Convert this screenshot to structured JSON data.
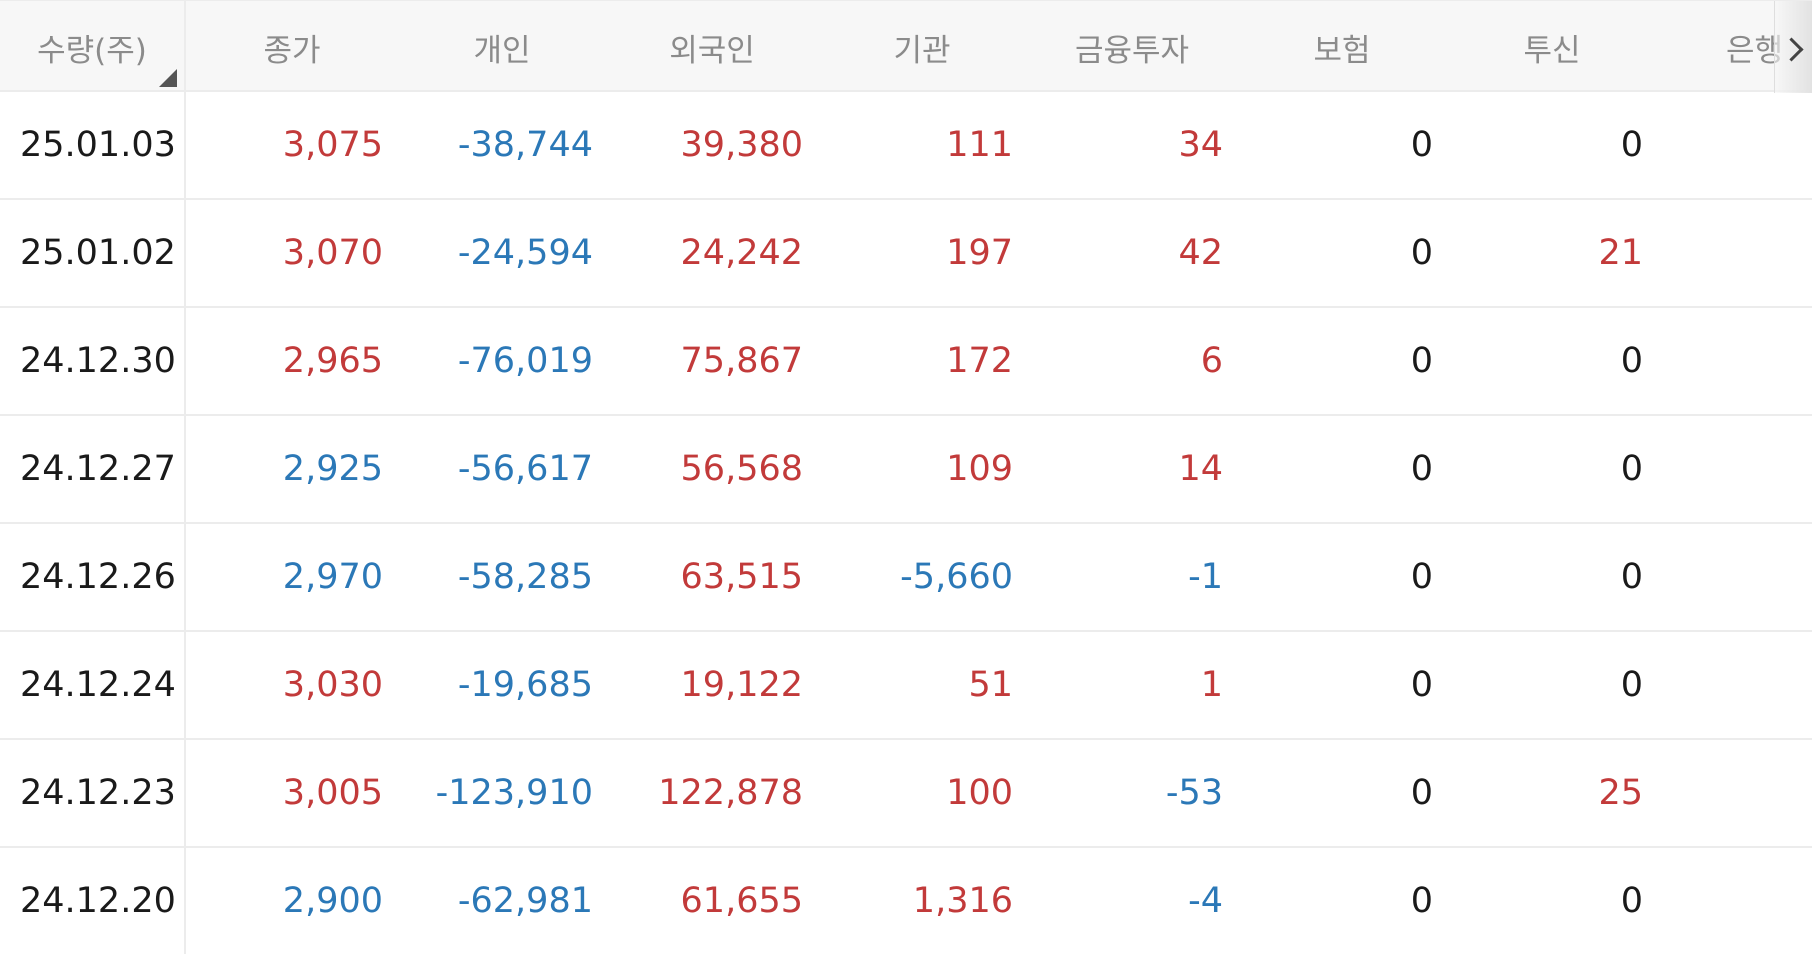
{
  "header": {
    "columns": [
      "수량(주)",
      "종가",
      "개인",
      "외국인",
      "기관",
      "금융투자",
      "보험",
      "투신",
      "은행"
    ]
  },
  "rows": [
    {
      "date": "25.01.03",
      "values": [
        "3,075",
        "-38,744",
        "39,380",
        "111",
        "34",
        "0",
        "0"
      ],
      "signs": [
        "pos",
        "neg",
        "pos",
        "pos",
        "pos",
        "zero",
        "zero"
      ]
    },
    {
      "date": "25.01.02",
      "values": [
        "3,070",
        "-24,594",
        "24,242",
        "197",
        "42",
        "0",
        "21"
      ],
      "signs": [
        "pos",
        "neg",
        "pos",
        "pos",
        "pos",
        "zero",
        "pos"
      ]
    },
    {
      "date": "24.12.30",
      "values": [
        "2,965",
        "-76,019",
        "75,867",
        "172",
        "6",
        "0",
        "0"
      ],
      "signs": [
        "pos",
        "neg",
        "pos",
        "pos",
        "pos",
        "zero",
        "zero"
      ]
    },
    {
      "date": "24.12.27",
      "values": [
        "2,925",
        "-56,617",
        "56,568",
        "109",
        "14",
        "0",
        "0"
      ],
      "signs": [
        "neg",
        "neg",
        "pos",
        "pos",
        "pos",
        "zero",
        "zero"
      ]
    },
    {
      "date": "24.12.26",
      "values": [
        "2,970",
        "-58,285",
        "63,515",
        "-5,660",
        "-1",
        "0",
        "0"
      ],
      "signs": [
        "neg",
        "neg",
        "pos",
        "neg",
        "neg",
        "zero",
        "zero"
      ]
    },
    {
      "date": "24.12.24",
      "values": [
        "3,030",
        "-19,685",
        "19,122",
        "51",
        "1",
        "0",
        "0"
      ],
      "signs": [
        "pos",
        "neg",
        "pos",
        "pos",
        "pos",
        "zero",
        "zero"
      ]
    },
    {
      "date": "24.12.23",
      "values": [
        "3,005",
        "-123,910",
        "122,878",
        "100",
        "-53",
        "0",
        "25"
      ],
      "signs": [
        "pos",
        "neg",
        "pos",
        "pos",
        "neg",
        "zero",
        "pos"
      ]
    },
    {
      "date": "24.12.20",
      "values": [
        "2,900",
        "-62,981",
        "61,655",
        "1,316",
        "-4",
        "0",
        "0"
      ],
      "signs": [
        "neg",
        "neg",
        "pos",
        "pos",
        "neg",
        "zero",
        "zero"
      ]
    }
  ],
  "colors": {
    "positive": "#c23a3a",
    "negative": "#2b78b7",
    "neutral": "#1a1a1a",
    "header_text": "#8b8b8b"
  }
}
